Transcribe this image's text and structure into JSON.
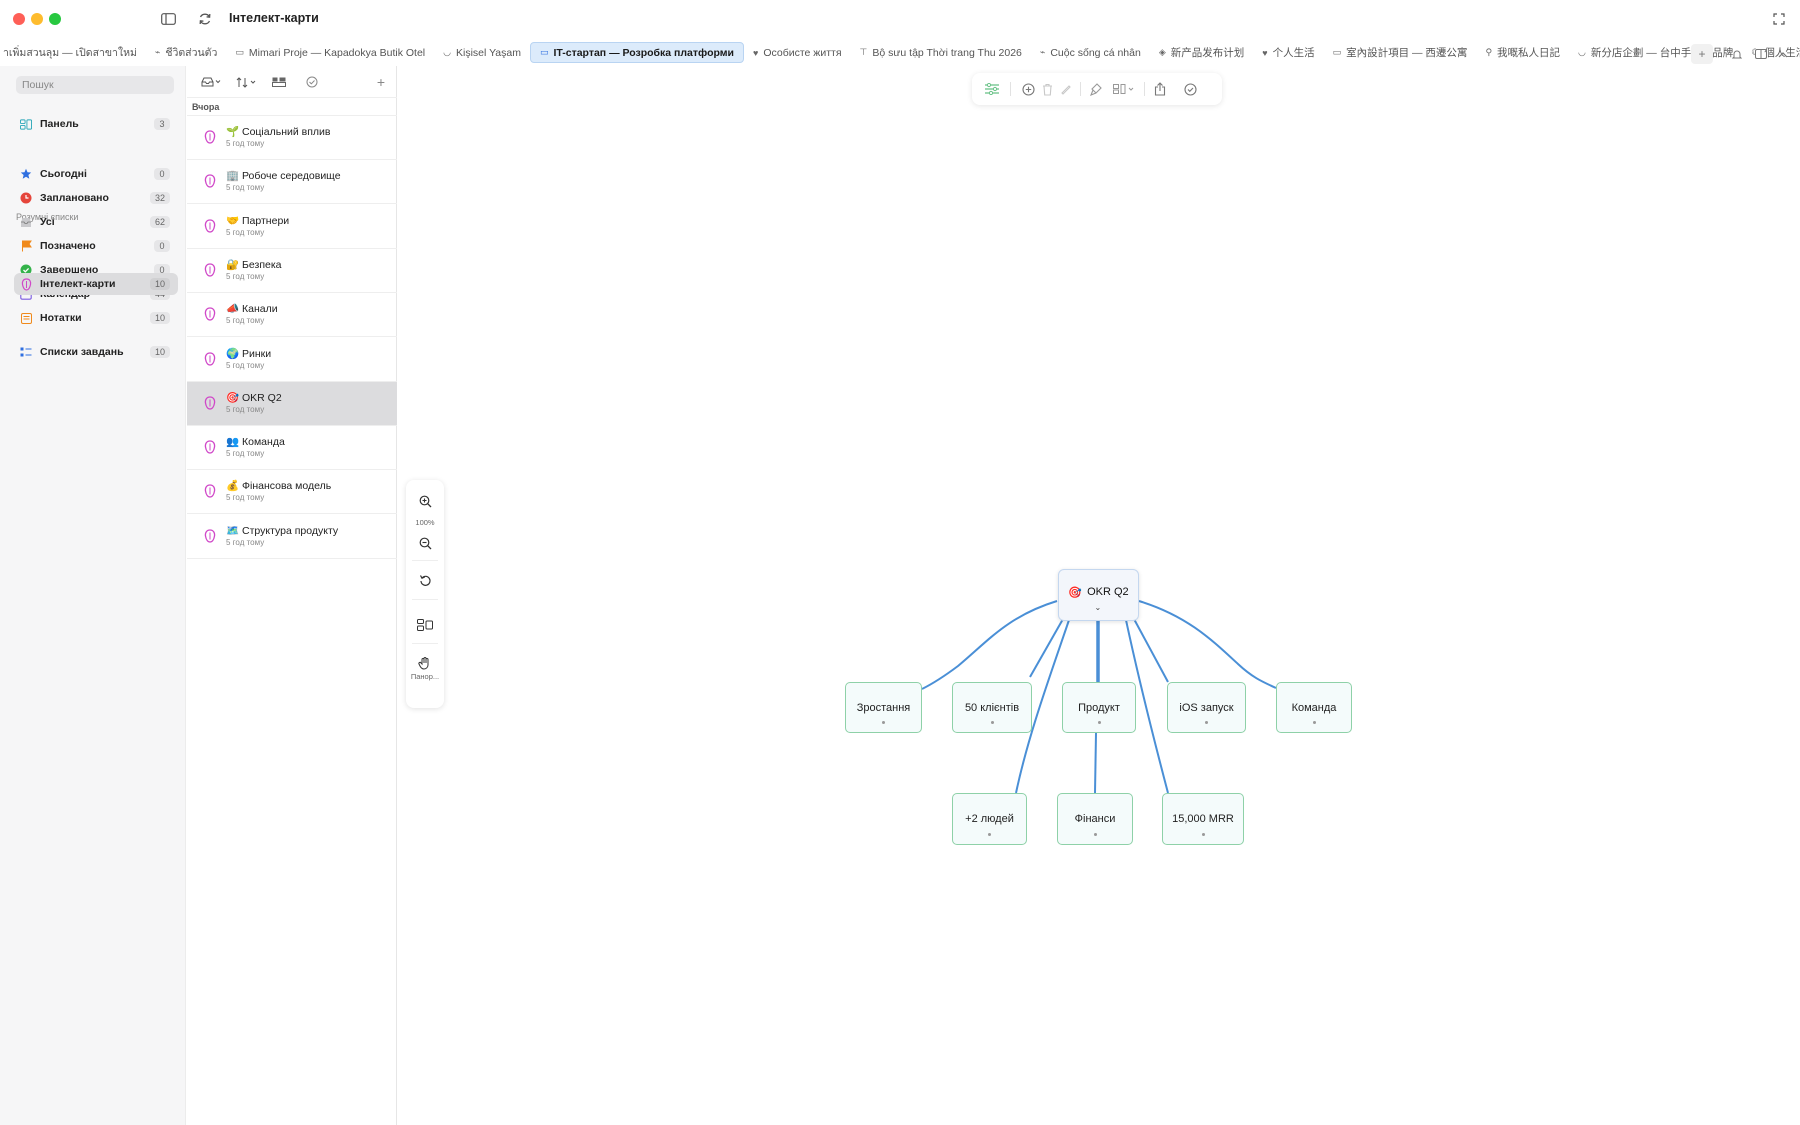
{
  "window": {
    "title": "Інтелект-карти"
  },
  "tabs": [
    {
      "label": "าเพิ่มสวนลุม — เปิดสาขาใหม่",
      "icon": "none",
      "active": false
    },
    {
      "label": "ชีวิตส่วนตัว",
      "icon": "tag-icon",
      "active": false
    },
    {
      "label": "Mimari Proje — Kapadokya Butik Otel",
      "icon": "sofa-icon",
      "active": false
    },
    {
      "label": "Kişisel Yaşam",
      "icon": "cup-icon",
      "active": false
    },
    {
      "label": "IT-стартап — Розробка платформи",
      "icon": "laptop-icon",
      "active": true
    },
    {
      "label": "Особисте життя",
      "icon": "heart-icon",
      "active": false
    },
    {
      "label": "Bộ sưu tập Thời trang Thu 2026",
      "icon": "shirt-icon",
      "active": false
    },
    {
      "label": "Cuộc sống cá nhân",
      "icon": "tag-icon",
      "active": false
    },
    {
      "label": "新产品发布计划",
      "icon": "box-icon",
      "active": false
    },
    {
      "label": "个人生活",
      "icon": "heart-icon",
      "active": false
    },
    {
      "label": "室內設計項目 — 西遷公寓",
      "icon": "sofa-icon",
      "active": false
    },
    {
      "label": "我嘅私人日記",
      "icon": "walk-icon",
      "active": false
    },
    {
      "label": "新分店企劃 — 台中手搖飲品牌",
      "icon": "cup-icon",
      "active": false
    },
    {
      "label": "個人生活",
      "icon": "moon-icon",
      "active": false
    }
  ],
  "sidebar": {
    "search_placeholder": "Пошук",
    "dashboard": {
      "label": "Панель",
      "count": "3"
    },
    "smart_lists_title": "Розумні списки",
    "smart_lists": [
      {
        "label": "Сьогодні",
        "count": "0",
        "icon": "star-icon",
        "color": "#2f6fe0"
      },
      {
        "label": "Заплановано",
        "count": "32",
        "icon": "clock-icon",
        "color": "#e5453b"
      },
      {
        "label": "Усі",
        "count": "62",
        "icon": "tray-icon",
        "color": "#777777"
      },
      {
        "label": "Позначено",
        "count": "0",
        "icon": "flag-icon",
        "color": "#f08a1c"
      },
      {
        "label": "Завершено",
        "count": "0",
        "icon": "check-circle-icon",
        "color": "#33b24a"
      },
      {
        "label": "Календар",
        "count": "44",
        "icon": "calendar-icon",
        "color": "#7a5ae0"
      }
    ],
    "mindmaps": {
      "label": "Інтелект-карти",
      "count": "10"
    },
    "notes": {
      "label": "Нотатки",
      "count": "10"
    },
    "tasklists": {
      "label": "Списки завдань",
      "count": "10"
    }
  },
  "note_list": {
    "group_label": "Вчора",
    "items": [
      {
        "emoji": "🌱",
        "title": "Соціальний вплив",
        "time": "5 год тому"
      },
      {
        "emoji": "🏢",
        "title": "Робоче середовище",
        "time": "5 год тому"
      },
      {
        "emoji": "🤝",
        "title": "Партнери",
        "time": "5 год тому"
      },
      {
        "emoji": "🔐",
        "title": "Безпека",
        "time": "5 год тому"
      },
      {
        "emoji": "📣",
        "title": "Канали",
        "time": "5 год тому"
      },
      {
        "emoji": "🌍",
        "title": "Ринки",
        "time": "5 год тому"
      },
      {
        "emoji": "🎯",
        "title": "OKR Q2",
        "time": "5 год тому"
      },
      {
        "emoji": "👥",
        "title": "Команда",
        "time": "5 год тому"
      },
      {
        "emoji": "💰",
        "title": "Фінансова модель",
        "time": "5 год тому"
      },
      {
        "emoji": "🗺️",
        "title": "Структура продукту",
        "time": "5 год тому"
      }
    ]
  },
  "zoom": {
    "level": "100%",
    "pan_label": "Панор..."
  },
  "mindmap": {
    "root": {
      "emoji": "🎯",
      "label": "OKR Q2"
    },
    "children": [
      {
        "label": "Зростання"
      },
      {
        "label": "50 клієнтів"
      },
      {
        "label": "Продукт"
      },
      {
        "label": "iOS запуск"
      },
      {
        "label": "Команда"
      },
      {
        "label": "+2 людей"
      },
      {
        "label": "Фінанси"
      },
      {
        "label": "15,000 MRR"
      }
    ]
  },
  "colors": {
    "accent": "#2f6fe0",
    "mindmap_edge": "#4a8fd6",
    "node_border": "#8ed1a8",
    "root_border": "#c4d7ef",
    "selected_bg": "#dcdcde",
    "active_tab_bg": "#dcebfb"
  }
}
